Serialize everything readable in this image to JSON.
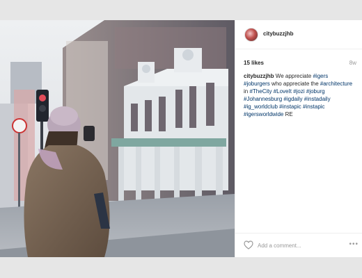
{
  "post": {
    "username": "citybuzzjhb",
    "likes": "15 likes",
    "timestamp": "8w",
    "caption": {
      "user": "citybuzzjhb",
      "segments": [
        {
          "text": "We appreciate ",
          "tag": false
        },
        {
          "text": "#igers",
          "tag": true
        },
        {
          "text": " ",
          "tag": false
        },
        {
          "text": "#joburgers",
          "tag": true
        },
        {
          "text": " who appreciate the ",
          "tag": false
        },
        {
          "text": "#architecture",
          "tag": true
        },
        {
          "text": " in ",
          "tag": false
        },
        {
          "text": "#TheCity",
          "tag": true
        },
        {
          "text": " ",
          "tag": false
        },
        {
          "text": "#LoveIt",
          "tag": true
        },
        {
          "text": " ",
          "tag": false
        },
        {
          "text": "#jozi",
          "tag": true
        },
        {
          "text": " ",
          "tag": false
        },
        {
          "text": "#joburg",
          "tag": true
        },
        {
          "text": " ",
          "tag": false
        },
        {
          "text": "#Johannesburg",
          "tag": true
        },
        {
          "text": " ",
          "tag": false
        },
        {
          "text": "#igdaily",
          "tag": true
        },
        {
          "text": " ",
          "tag": false
        },
        {
          "text": "#instadaily",
          "tag": true
        },
        {
          "text": " ",
          "tag": false
        },
        {
          "text": "#ig_worldclub",
          "tag": true
        },
        {
          "text": " ",
          "tag": false
        },
        {
          "text": "#instapic",
          "tag": true
        },
        {
          "text": " ",
          "tag": false
        },
        {
          "text": "#instapic",
          "tag": true
        },
        {
          "text": " ",
          "tag": false
        },
        {
          "text": "#igersworldwide",
          "tag": true
        },
        {
          "text": " RE",
          "tag": false
        }
      ]
    },
    "comment_placeholder": "Add a comment...",
    "more_label": "•••",
    "icons": {
      "like": "heart-icon",
      "more": "more-options-icon"
    }
  },
  "colors": {
    "hashtag": "#003569",
    "text": "#262626",
    "muted": "#999999",
    "background": "#e6e6e6"
  }
}
